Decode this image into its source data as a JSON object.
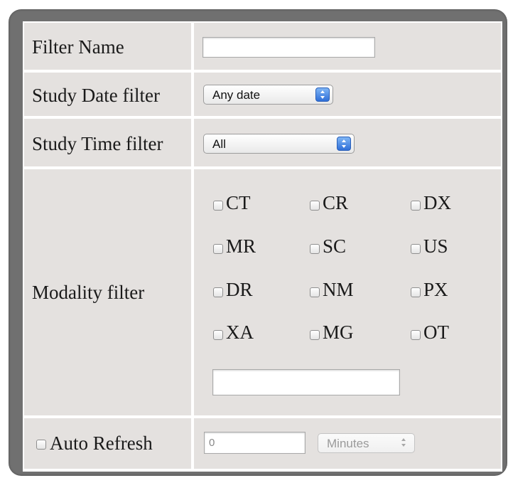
{
  "filter_name": {
    "label": "Filter Name",
    "value": ""
  },
  "study_date": {
    "label": "Study Date filter",
    "selected": "Any date"
  },
  "study_time": {
    "label": "Study Time filter",
    "selected": "All"
  },
  "modality": {
    "label": "Modality filter",
    "options": [
      "CT",
      "CR",
      "DX",
      "MR",
      "SC",
      "US",
      "DR",
      "NM",
      "PX",
      "XA",
      "MG",
      "OT"
    ],
    "custom_value": ""
  },
  "auto_refresh": {
    "label": "Auto Refresh",
    "interval_value": "0",
    "unit": "Minutes"
  },
  "icons": {
    "select_arrow": "up-down-chevron-icon",
    "checkbox": "checkbox-icon"
  },
  "colors": {
    "cell_bg": "#e4e1df",
    "frame": "#707070",
    "select_arrow": "#3b7de0"
  }
}
